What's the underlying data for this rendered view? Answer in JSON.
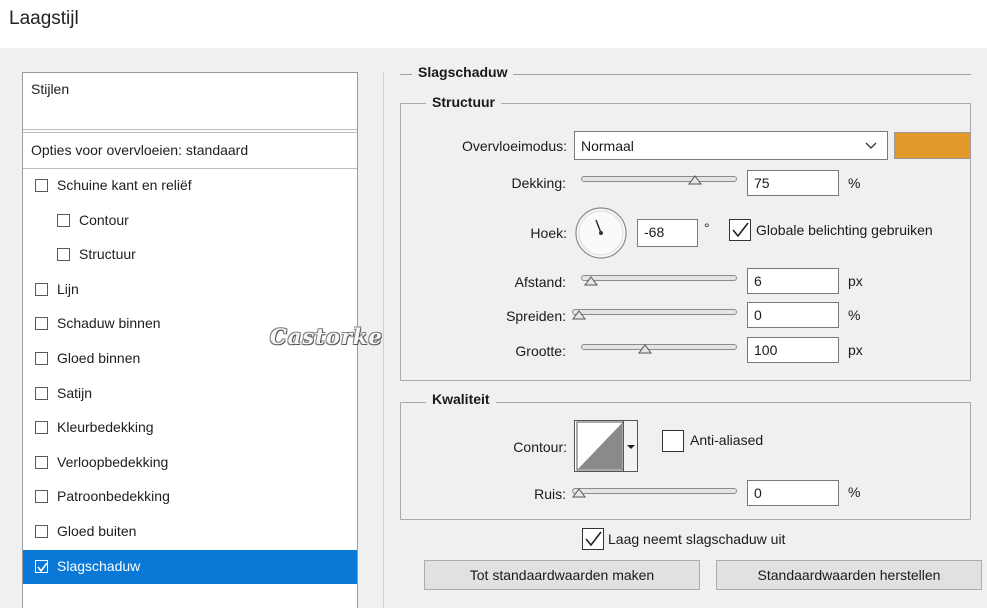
{
  "window": {
    "title": "Laagstijl"
  },
  "sidebar": {
    "header": "Stijlen",
    "blending": "Opties voor overvloeien: standaard",
    "items": [
      {
        "label": "Schuine kant en reliëf",
        "checked": false,
        "indent": false
      },
      {
        "label": "Contour",
        "checked": false,
        "indent": true
      },
      {
        "label": "Structuur",
        "checked": false,
        "indent": true
      },
      {
        "label": "Lijn",
        "checked": false,
        "indent": false
      },
      {
        "label": "Schaduw binnen",
        "checked": false,
        "indent": false
      },
      {
        "label": "Gloed binnen",
        "checked": false,
        "indent": false
      },
      {
        "label": "Satijn",
        "checked": false,
        "indent": false
      },
      {
        "label": "Kleurbedekking",
        "checked": false,
        "indent": false
      },
      {
        "label": "Verloopbedekking",
        "checked": false,
        "indent": false
      },
      {
        "label": "Patroonbedekking",
        "checked": false,
        "indent": false
      },
      {
        "label": "Gloed buiten",
        "checked": false,
        "indent": false
      },
      {
        "label": "Slagschaduw",
        "checked": true,
        "indent": false,
        "selected": true
      }
    ]
  },
  "watermark": "Castorke",
  "panel": {
    "title": "Slagschaduw",
    "structuur": {
      "title": "Structuur",
      "blend_mode_label": "Overvloeimodus:",
      "blend_mode_value": "Normaal",
      "shadow_color": "#e39a2b",
      "opacity_label": "Dekking:",
      "opacity_value": "75",
      "opacity_unit": "%",
      "opacity_fraction": 0.75,
      "angle_label": "Hoek:",
      "angle_value": "-68",
      "angle_unit": "°",
      "global_light_label": "Globale belichting gebruiken",
      "global_light_checked": true,
      "distance_label": "Afstand:",
      "distance_value": "6",
      "distance_unit": "px",
      "distance_fraction": 0.02,
      "spread_label": "Spreiden:",
      "spread_value": "0",
      "spread_unit": "%",
      "spread_fraction": 0.0,
      "size_label": "Grootte:",
      "size_value": "100",
      "size_unit": "px",
      "size_fraction": 0.4
    },
    "kwaliteit": {
      "title": "Kwaliteit",
      "contour_label": "Contour:",
      "antialiased_label": "Anti-aliased",
      "antialiased_checked": false,
      "noise_label": "Ruis:",
      "noise_value": "0",
      "noise_unit": "%",
      "noise_fraction": 0.0
    },
    "knockout_label": "Laag neemt slagschaduw uit",
    "knockout_checked": true,
    "make_default_button": "Tot standaardwaarden maken",
    "reset_default_button": "Standaardwaarden herstellen"
  }
}
